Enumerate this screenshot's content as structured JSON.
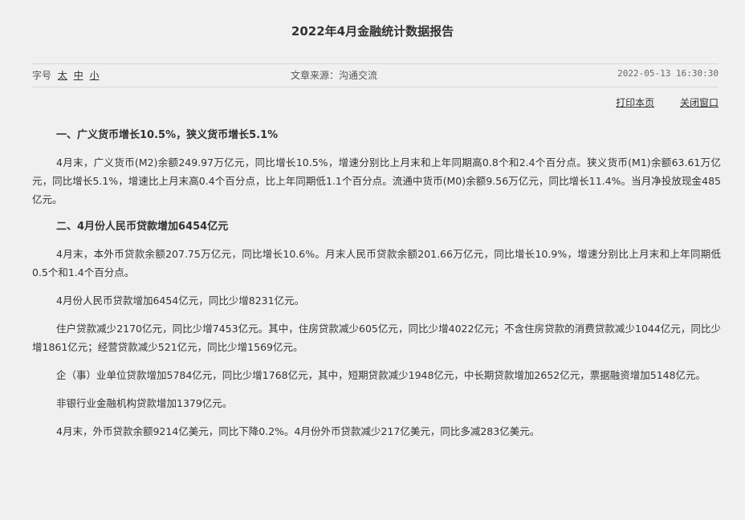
{
  "article": {
    "title": "2022年4月金融统计数据报告",
    "font_size_label": "字号",
    "font_sizes": [
      "太",
      "中",
      "小"
    ],
    "source": "文章来源：沟通交流",
    "datetime": "2022-05-13  16:30:30",
    "print_label": "打印本页",
    "close_label": "关闭窗口"
  },
  "sections": [
    {
      "heading": "一、广义货币增长10.5%，狭义货币增长5.1%",
      "paragraphs": [
        "4月末，广义货币(M2)余额249.97万亿元，同比增长10.5%，增速分别比上月末和上年同期高0.8个和2.4个百分点。狭义货币(M1)余额63.61万亿元，同比增长5.1%，增速比上月末高0.4个百分点，比上年同期低1.1个百分点。流通中货币(M0)余额9.56万亿元，同比增长11.4%。当月净投放现金485亿元。"
      ]
    },
    {
      "heading": "二、4月份人民币贷款增加6454亿元",
      "paragraphs": [
        "4月末，本外币贷款余额207.75万亿元，同比增长10.6%。月末人民币贷款余额201.66万亿元，同比增长10.9%，增速分别比上月末和上年同期低0.5个和1.4个百分点。",
        "4月份人民币贷款增加6454亿元，同比少增8231亿元。",
        "住户贷款减少2170亿元，同比少增7453亿元。其中，住房贷款减少605亿元，同比少增4022亿元；不含住房贷款的消费贷款减少1044亿元，同比少增1861亿元；经营贷款减少521亿元，同比少增1569亿元。",
        "企（事）业单位贷款增加5784亿元，同比少增1768亿元，其中，短期贷款减少1948亿元，中长期贷款增加2652亿元，票据融资增加5148亿元。",
        "非银行业金融机构贷款增加1379亿元。",
        "4月末，外币贷款余额9214亿美元，同比下降0.2%。4月份外币贷款减少217亿美元，同比多减283亿美元。"
      ]
    }
  ]
}
